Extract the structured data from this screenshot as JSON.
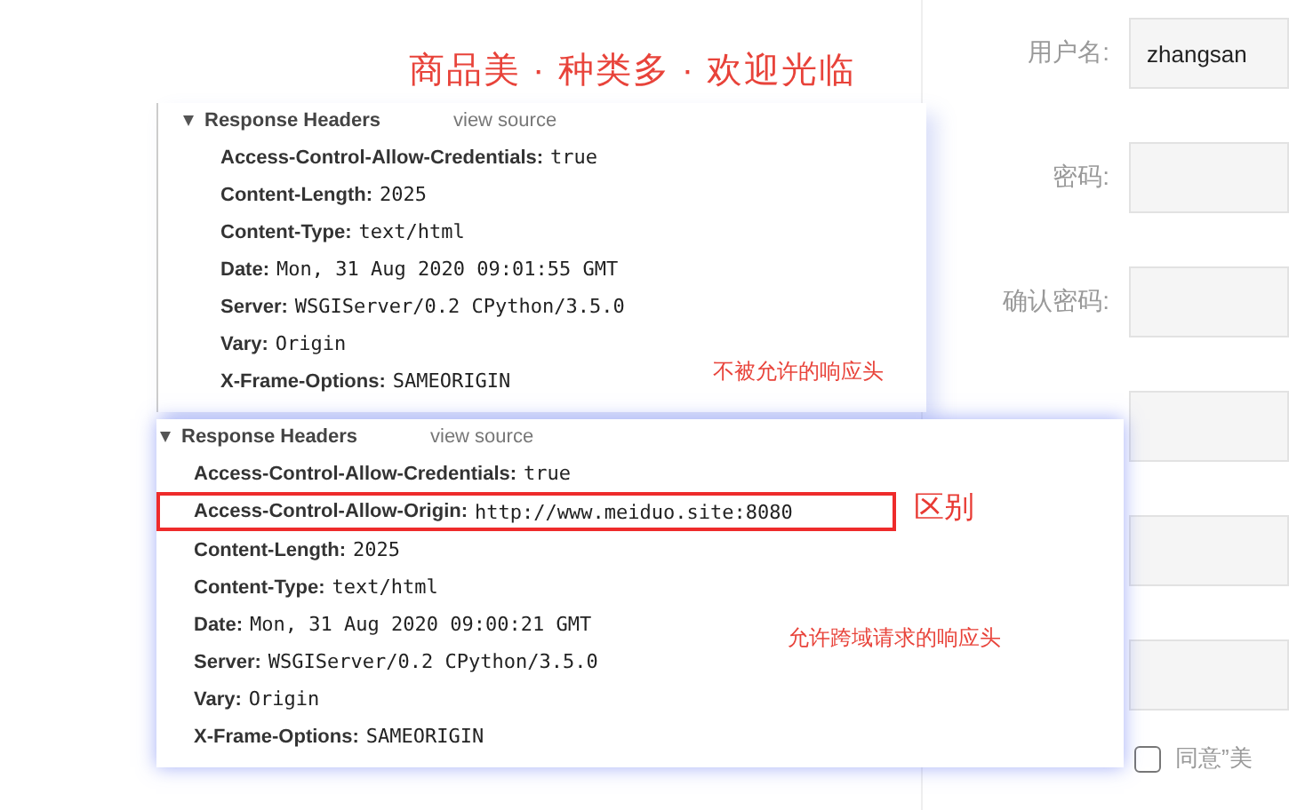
{
  "banner": "商品美 · 种类多 · 欢迎光临",
  "form": {
    "fields": [
      {
        "kind": "text",
        "label": "用户名:",
        "value": "zhangsan"
      },
      {
        "kind": "text",
        "label": "密码:"
      },
      {
        "kind": "text",
        "label": "确认密码:"
      },
      {
        "kind": "text"
      },
      {
        "kind": "text"
      },
      {
        "kind": "text"
      }
    ],
    "agreement": {
      "checked": false,
      "label": "同意”美"
    }
  },
  "panels": [
    {
      "title": "Response Headers",
      "expanded": true,
      "link": "view source",
      "headers": [
        {
          "name": "Access-Control-Allow-Credentials:",
          "value": "true",
          "highlighted": false
        },
        {
          "name": "Content-Length:",
          "value": "2025",
          "highlighted": false
        },
        {
          "name": "Content-Type:",
          "value": "text/html",
          "highlighted": false
        },
        {
          "name": "Date:",
          "value": "Mon, 31 Aug 2020 09:01:55 GMT",
          "highlighted": false
        },
        {
          "name": "Server:",
          "value": "WSGIServer/0.2 CPython/3.5.0",
          "highlighted": false
        },
        {
          "name": "Vary:",
          "value": "Origin",
          "highlighted": false
        },
        {
          "name": "X-Frame-Options:",
          "value": "SAMEORIGIN",
          "highlighted": false
        }
      ],
      "annotation": "不被允许的响应头"
    },
    {
      "title": "Response Headers",
      "expanded": true,
      "link": "view source",
      "headers": [
        {
          "name": "Access-Control-Allow-Credentials:",
          "value": "true",
          "highlighted": false
        },
        {
          "name": "Access-Control-Allow-Origin:",
          "value": "http://www.meiduo.site:8080",
          "highlighted": true
        },
        {
          "name": "Content-Length:",
          "value": "2025",
          "highlighted": false
        },
        {
          "name": "Content-Type:",
          "value": "text/html",
          "highlighted": false
        },
        {
          "name": "Date:",
          "value": "Mon, 31 Aug 2020 09:00:21 GMT",
          "highlighted": false
        },
        {
          "name": "Server:",
          "value": "WSGIServer/0.2 CPython/3.5.0",
          "highlighted": false
        },
        {
          "name": "Vary:",
          "value": "Origin",
          "highlighted": false
        },
        {
          "name": "X-Frame-Options:",
          "value": "SAMEORIGIN",
          "highlighted": false
        }
      ],
      "highlight_note": "区别",
      "annotation": "允许跨域请求的响应头"
    }
  ]
}
